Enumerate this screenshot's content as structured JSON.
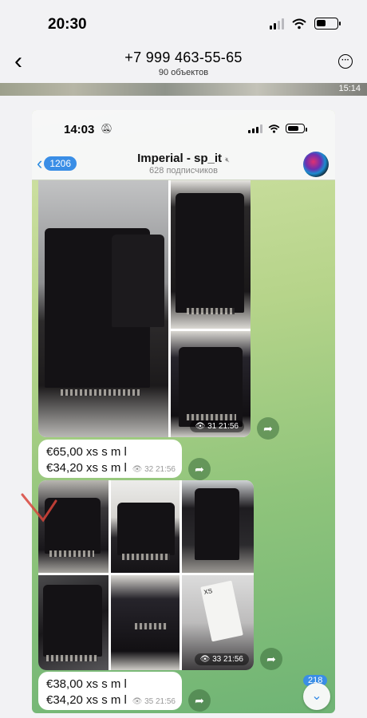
{
  "outer_status": {
    "time": "20:30"
  },
  "outer_header": {
    "back_icon": "‹",
    "phone": "+7 999 463-55-65",
    "subtitle": "90 объектов",
    "more_icon": "···"
  },
  "strip": {
    "time": "15:14"
  },
  "inner_status": {
    "time": "14:03"
  },
  "channel": {
    "back_badge": "1206",
    "name": "Imperial - sp_it",
    "subscribers": "628 подписчиков"
  },
  "album1": {
    "views": "31",
    "time": "21:56"
  },
  "price1": {
    "line1": "€65,00 xs s m l",
    "line2": "€34,20 xs s m l",
    "views": "32",
    "time": "21:56"
  },
  "album2": {
    "views": "33",
    "time": "21:56",
    "tag_text": "XS"
  },
  "price2": {
    "line1": "€38,00 xs s m l",
    "line2": "€34,20 xs s m l",
    "views": "35",
    "time": "21:56"
  },
  "unread_count": "218",
  "icons": {
    "eye": "eye-icon",
    "share": "share-icon",
    "mute": "mute-icon",
    "down": "chevron-down-icon"
  },
  "colors": {
    "accent": "#3a8ee6",
    "wallpaper": "#8fc47b"
  }
}
